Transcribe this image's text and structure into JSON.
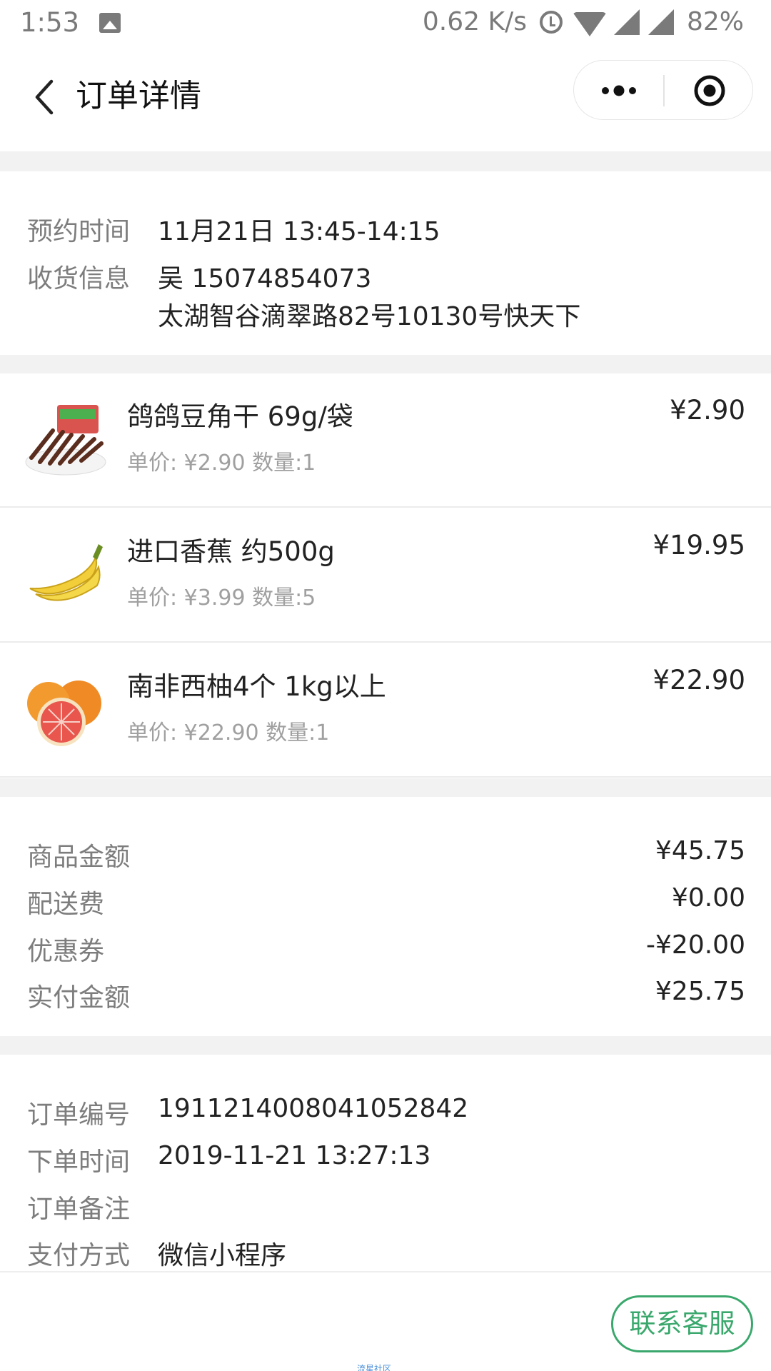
{
  "status_bar": {
    "time": "1:53",
    "speed": "0.62 K/s",
    "battery": "82%"
  },
  "nav": {
    "title": "订单详情"
  },
  "delivery": {
    "time_label": "预约时间",
    "time_value": "11月21日 13:45-14:15",
    "receiver_label": "收货信息",
    "receiver_name_phone": "吴 15074854073",
    "receiver_address": "太湖智谷滴翠路82号10130号快天下"
  },
  "products": [
    {
      "name": "鸽鸽豆角干 69g/袋",
      "meta": "单价: ¥2.90 数量:1",
      "price": "¥2.90",
      "icon": "dried-beans-image"
    },
    {
      "name": "进口香蕉 约500g",
      "meta": "单价: ¥3.99 数量:5",
      "price": "¥19.95",
      "icon": "banana-image"
    },
    {
      "name": "南非西柚4个 1kg以上",
      "meta": "单价: ¥22.90 数量:1",
      "price": "¥22.90",
      "icon": "grapefruit-image"
    }
  ],
  "summary": {
    "goods_label": "商品金额",
    "goods_value": "¥45.75",
    "delivery_label": "配送费",
    "delivery_value": "¥0.00",
    "coupon_label": "优惠券",
    "coupon_value": "-¥20.00",
    "paid_label": "实付金额",
    "paid_value": "¥25.75"
  },
  "order_info": {
    "number_label": "订单编号",
    "number_value": "1911214008041052842",
    "time_label": "下单时间",
    "time_value": "2019-11-21 13:27:13",
    "note_label": "订单备注",
    "note_value": "",
    "pay_label": "支付方式",
    "pay_value": "微信小程序"
  },
  "bottom": {
    "contact_label": "联系客服",
    "watermark": "流星社区"
  },
  "colors": {
    "accent": "#3aa86c",
    "separator": "#f2f2f2",
    "label": "#7d7d7d"
  }
}
